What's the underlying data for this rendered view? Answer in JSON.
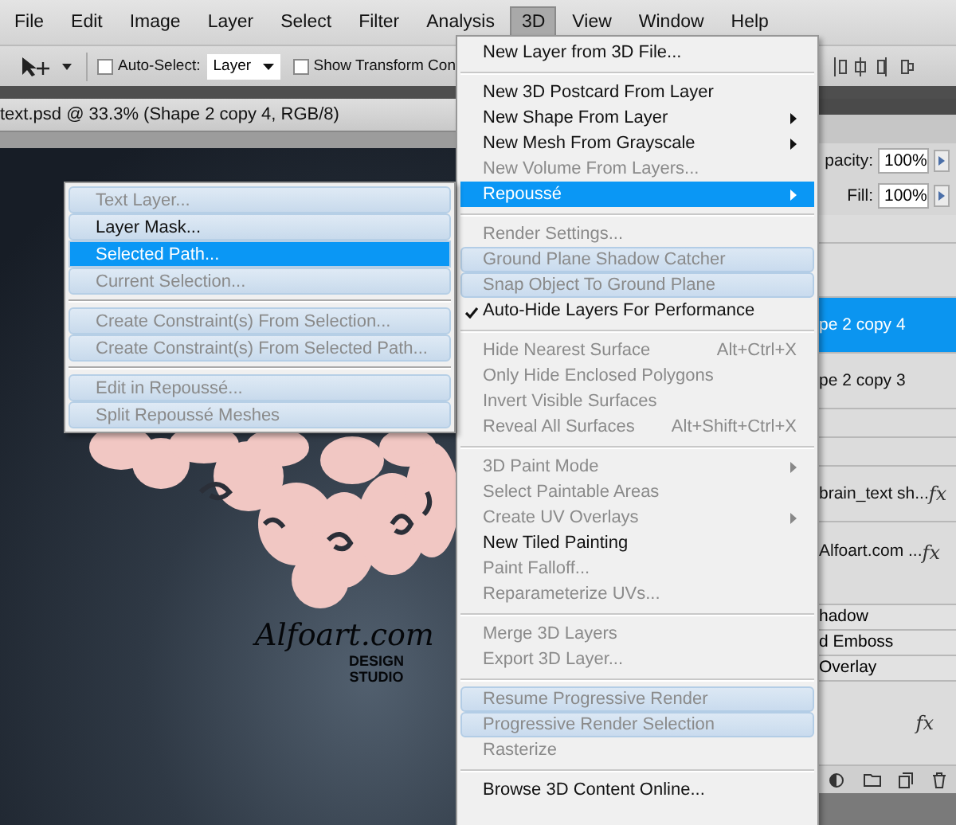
{
  "menubar": [
    {
      "label": "File",
      "selected": false
    },
    {
      "label": "Edit",
      "selected": false
    },
    {
      "label": "Image",
      "selected": false
    },
    {
      "label": "Layer",
      "selected": false
    },
    {
      "label": "Select",
      "selected": false
    },
    {
      "label": "Filter",
      "selected": false
    },
    {
      "label": "Analysis",
      "selected": false
    },
    {
      "label": "3D",
      "selected": true
    },
    {
      "label": "View",
      "selected": false
    },
    {
      "label": "Window",
      "selected": false
    },
    {
      "label": "Help",
      "selected": false
    }
  ],
  "options_bar": {
    "auto_select": {
      "label": "Auto-Select:",
      "checked": false
    },
    "target": {
      "value": "Layer"
    },
    "show_transform": {
      "label": "Show Transform Con",
      "checked": false
    }
  },
  "document": {
    "title": "text.psd @ 33.3% (Shape 2 copy 4, RGB/8)",
    "canvas": {
      "logo": "Alfoart.com",
      "tagline_1": "DESIGN",
      "tagline_2": "STUDIO"
    }
  },
  "menu_3d": [
    {
      "kind": "item",
      "label": "New Layer from 3D File...",
      "disabled": false,
      "selected": false,
      "highlighted": false,
      "checked": false,
      "submenu": false
    },
    {
      "kind": "separator"
    },
    {
      "kind": "item",
      "label": "New 3D Postcard From Layer",
      "disabled": false,
      "selected": false,
      "highlighted": false,
      "checked": false,
      "submenu": false
    },
    {
      "kind": "item",
      "label": "New Shape From Layer",
      "disabled": false,
      "selected": false,
      "highlighted": false,
      "checked": false,
      "submenu": true
    },
    {
      "kind": "item",
      "label": "New Mesh From Grayscale",
      "disabled": false,
      "selected": false,
      "highlighted": false,
      "checked": false,
      "submenu": true
    },
    {
      "kind": "item",
      "label": "New Volume From Layers...",
      "disabled": true,
      "selected": false,
      "highlighted": false,
      "checked": false,
      "submenu": false
    },
    {
      "kind": "item",
      "label": "Repoussé",
      "disabled": false,
      "selected": true,
      "highlighted": false,
      "checked": false,
      "submenu": true
    },
    {
      "kind": "separator"
    },
    {
      "kind": "item",
      "label": "Render Settings...",
      "disabled": true,
      "selected": false,
      "highlighted": false,
      "checked": false,
      "submenu": false
    },
    {
      "kind": "item",
      "label": "Ground Plane Shadow Catcher",
      "disabled": true,
      "selected": false,
      "highlighted": true,
      "checked": false,
      "submenu": false
    },
    {
      "kind": "item",
      "label": "Snap Object To Ground Plane",
      "disabled": true,
      "selected": false,
      "highlighted": true,
      "checked": false,
      "submenu": false
    },
    {
      "kind": "item",
      "label": "Auto-Hide Layers For Performance",
      "disabled": false,
      "selected": false,
      "highlighted": false,
      "checked": true,
      "submenu": false
    },
    {
      "kind": "separator"
    },
    {
      "kind": "item",
      "label": "Hide Nearest Surface",
      "shortcut": "Alt+Ctrl+X",
      "disabled": true,
      "selected": false,
      "highlighted": false,
      "checked": false,
      "submenu": false
    },
    {
      "kind": "item",
      "label": "Only Hide Enclosed Polygons",
      "disabled": true,
      "selected": false,
      "highlighted": false,
      "checked": false,
      "submenu": false
    },
    {
      "kind": "item",
      "label": "Invert Visible Surfaces",
      "disabled": true,
      "selected": false,
      "highlighted": false,
      "checked": false,
      "submenu": false
    },
    {
      "kind": "item",
      "label": "Reveal All Surfaces",
      "shortcut": "Alt+Shift+Ctrl+X",
      "disabled": true,
      "selected": false,
      "highlighted": false,
      "checked": false,
      "submenu": false
    },
    {
      "kind": "separator"
    },
    {
      "kind": "item",
      "label": "3D Paint Mode",
      "disabled": true,
      "selected": false,
      "highlighted": false,
      "checked": false,
      "submenu": true
    },
    {
      "kind": "item",
      "label": "Select Paintable Areas",
      "disabled": true,
      "selected": false,
      "highlighted": false,
      "checked": false,
      "submenu": false
    },
    {
      "kind": "item",
      "label": "Create UV Overlays",
      "disabled": true,
      "selected": false,
      "highlighted": false,
      "checked": false,
      "submenu": true
    },
    {
      "kind": "item",
      "label": "New Tiled Painting",
      "disabled": false,
      "selected": false,
      "highlighted": false,
      "checked": false,
      "submenu": false
    },
    {
      "kind": "item",
      "label": "Paint Falloff...",
      "disabled": true,
      "selected": false,
      "highlighted": false,
      "checked": false,
      "submenu": false
    },
    {
      "kind": "item",
      "label": "Reparameterize UVs...",
      "disabled": true,
      "selected": false,
      "highlighted": false,
      "checked": false,
      "submenu": false
    },
    {
      "kind": "separator"
    },
    {
      "kind": "item",
      "label": "Merge 3D Layers",
      "disabled": true,
      "selected": false,
      "highlighted": false,
      "checked": false,
      "submenu": false
    },
    {
      "kind": "item",
      "label": "Export 3D Layer...",
      "disabled": true,
      "selected": false,
      "highlighted": false,
      "checked": false,
      "submenu": false
    },
    {
      "kind": "separator"
    },
    {
      "kind": "item",
      "label": "Resume Progressive Render",
      "disabled": true,
      "selected": false,
      "highlighted": true,
      "checked": false,
      "submenu": false
    },
    {
      "kind": "item",
      "label": "Progressive Render Selection",
      "disabled": true,
      "selected": false,
      "highlighted": true,
      "checked": false,
      "submenu": false
    },
    {
      "kind": "item",
      "label": "Rasterize",
      "disabled": true,
      "selected": false,
      "highlighted": false,
      "checked": false,
      "submenu": false
    },
    {
      "kind": "separator"
    },
    {
      "kind": "item",
      "label": "Browse 3D Content Online...",
      "disabled": false,
      "selected": false,
      "highlighted": false,
      "checked": false,
      "submenu": false
    }
  ],
  "repousse_submenu": [
    {
      "kind": "item",
      "label": "Text Layer...",
      "disabled": true,
      "selected": false
    },
    {
      "kind": "item",
      "label": "Layer Mask...",
      "disabled": false,
      "selected": false
    },
    {
      "kind": "item",
      "label": "Selected Path...",
      "disabled": false,
      "selected": true
    },
    {
      "kind": "item",
      "label": "Current Selection...",
      "disabled": true,
      "selected": false
    },
    {
      "kind": "separator"
    },
    {
      "kind": "item",
      "label": "Create Constraint(s) From Selection...",
      "disabled": true,
      "selected": false
    },
    {
      "kind": "item",
      "label": "Create Constraint(s) From Selected Path...",
      "disabled": true,
      "selected": false
    },
    {
      "kind": "separator"
    },
    {
      "kind": "item",
      "label": "Edit in Repoussé...",
      "disabled": true,
      "selected": false
    },
    {
      "kind": "item",
      "label": "Split Repoussé Meshes",
      "disabled": true,
      "selected": false
    }
  ],
  "layers_panel": {
    "opacity": {
      "label": "pacity:",
      "value": "100%"
    },
    "fill": {
      "label": "Fill:",
      "value": "100%"
    },
    "rows": [
      {
        "kind": "blank"
      },
      {
        "kind": "blank_tall"
      },
      {
        "kind": "layer",
        "name": "pe 2 copy 4",
        "selected": true
      },
      {
        "kind": "layer",
        "name": "pe 2 copy 3",
        "selected": false
      },
      {
        "kind": "blank"
      },
      {
        "kind": "blank"
      },
      {
        "kind": "layer",
        "name": "brain_text sh...",
        "selected": false,
        "fx": "fx"
      },
      {
        "kind": "layer",
        "name": "Alfoart.com ...",
        "selected": false,
        "fx": "fx",
        "tall": true
      },
      {
        "kind": "effect",
        "name": "hadow"
      },
      {
        "kind": "effect",
        "name": "d Emboss"
      },
      {
        "kind": "effect",
        "name": " Overlay"
      },
      {
        "kind": "fxrow",
        "fx": "fx"
      }
    ]
  }
}
